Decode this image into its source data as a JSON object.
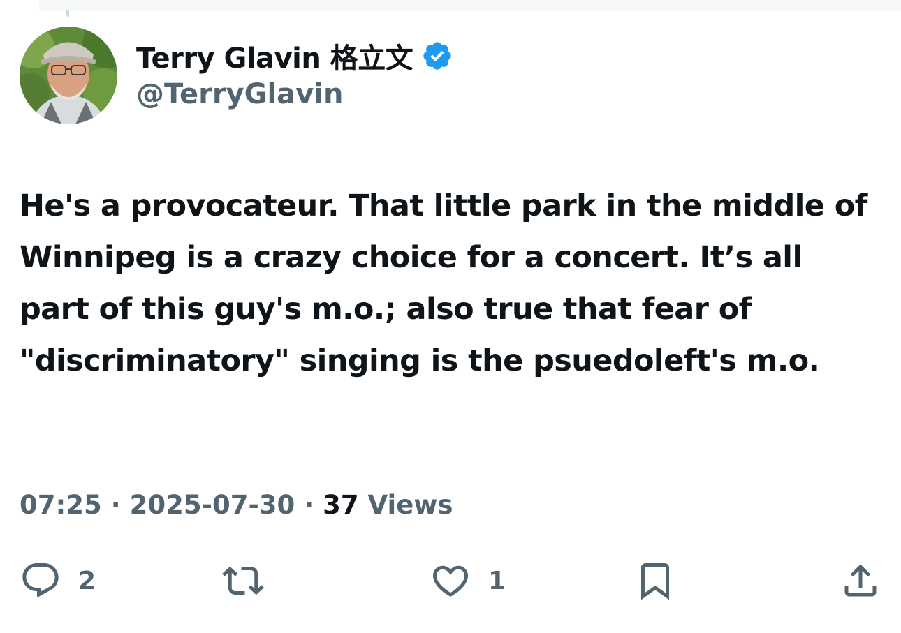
{
  "author": {
    "display_name": "Terry Glavin 格立文",
    "handle": "@TerryGlavin",
    "verified_icon": "verified-badge-icon",
    "verified_color": "#1d9bf0"
  },
  "tweet": {
    "text": "He's a provocateur. That little park in the middle of Winnipeg is a crazy choice for a concert. It’s all part of this guy's m.o.; also true that fear of \"discriminatory\" singing is the psuedoleft's m.o."
  },
  "meta": {
    "time": "07:25",
    "separator": "·",
    "date": "2025-07-30",
    "views_count": "37",
    "views_label": "Views"
  },
  "actions": {
    "reply": {
      "icon": "reply-icon",
      "count": "2"
    },
    "repost": {
      "icon": "repost-icon",
      "count": ""
    },
    "like": {
      "icon": "heart-icon",
      "count": "1"
    },
    "bookmark": {
      "icon": "bookmark-icon"
    },
    "share": {
      "icon": "share-icon"
    }
  },
  "colors": {
    "text": "#0f1419",
    "secondary": "#536471",
    "accent": "#1d9bf0"
  }
}
